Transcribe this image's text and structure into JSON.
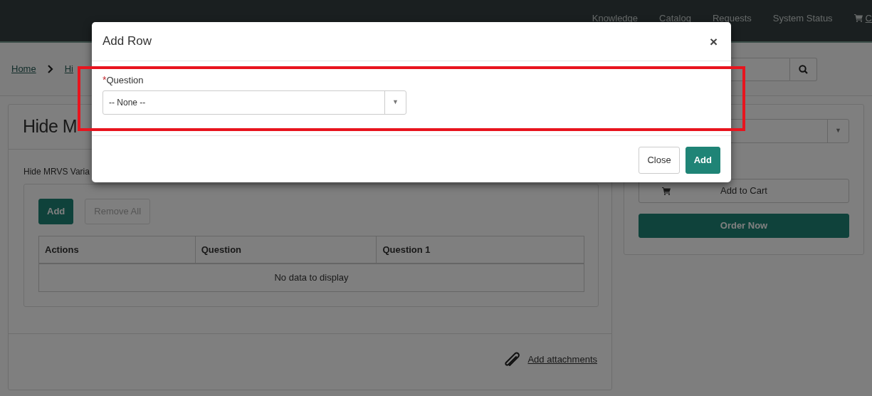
{
  "navbar": {
    "links": [
      {
        "label": "Knowledge"
      },
      {
        "label": "Catalog"
      },
      {
        "label": "Requests"
      },
      {
        "label": "System Status"
      }
    ],
    "cart_label": "C"
  },
  "breadcrumb": [
    {
      "label": "Home"
    },
    {
      "label": "Hi"
    }
  ],
  "item": {
    "title": "Hide M",
    "variable_label": "Hide MRVS Varia",
    "buttons": [
      {
        "label": "Add",
        "disabled": false
      },
      {
        "label": "Remove All",
        "disabled": true
      }
    ],
    "table": {
      "columns": [
        "Actions",
        "Question",
        "Question 1"
      ],
      "empty_message": "No data to display"
    },
    "attachments_label": "Add attachments"
  },
  "order_panel": {
    "select_caret": "▼",
    "buttons": [
      {
        "label": "Add to Cart",
        "kind": "cart"
      },
      {
        "label": "Order Now",
        "kind": "primary"
      }
    ]
  },
  "modal": {
    "title": "Add Row",
    "close_symbol": "×",
    "field": {
      "label": "Question",
      "required": true,
      "required_mark": "*",
      "value": "-- None --",
      "caret": "▼"
    },
    "buttons": [
      {
        "label": "Close",
        "kind": "secondary"
      },
      {
        "label": "Add",
        "kind": "primary"
      }
    ]
  }
}
